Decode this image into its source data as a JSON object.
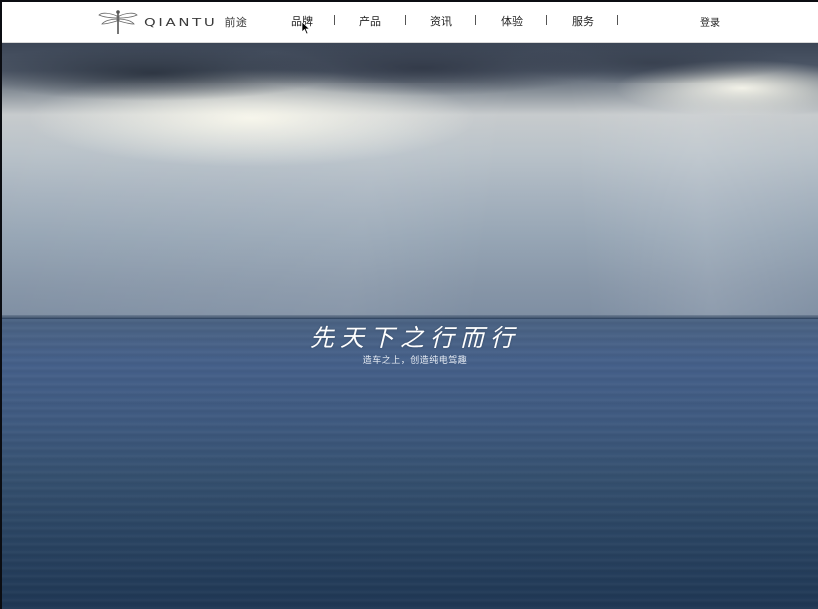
{
  "header": {
    "logo_text": "QIANTU",
    "logo_cn": "前途",
    "nav": [
      {
        "label": "品牌"
      },
      {
        "label": "产品"
      },
      {
        "label": "资讯"
      },
      {
        "label": "体验"
      },
      {
        "label": "服务"
      }
    ],
    "login_label": "登录"
  },
  "hero": {
    "title": "先天下之行而行",
    "subtitle": "造车之上，创造纯电驾趣"
  },
  "icons": {
    "logo": "dragonfly-icon",
    "cursor": "cursor-icon"
  }
}
